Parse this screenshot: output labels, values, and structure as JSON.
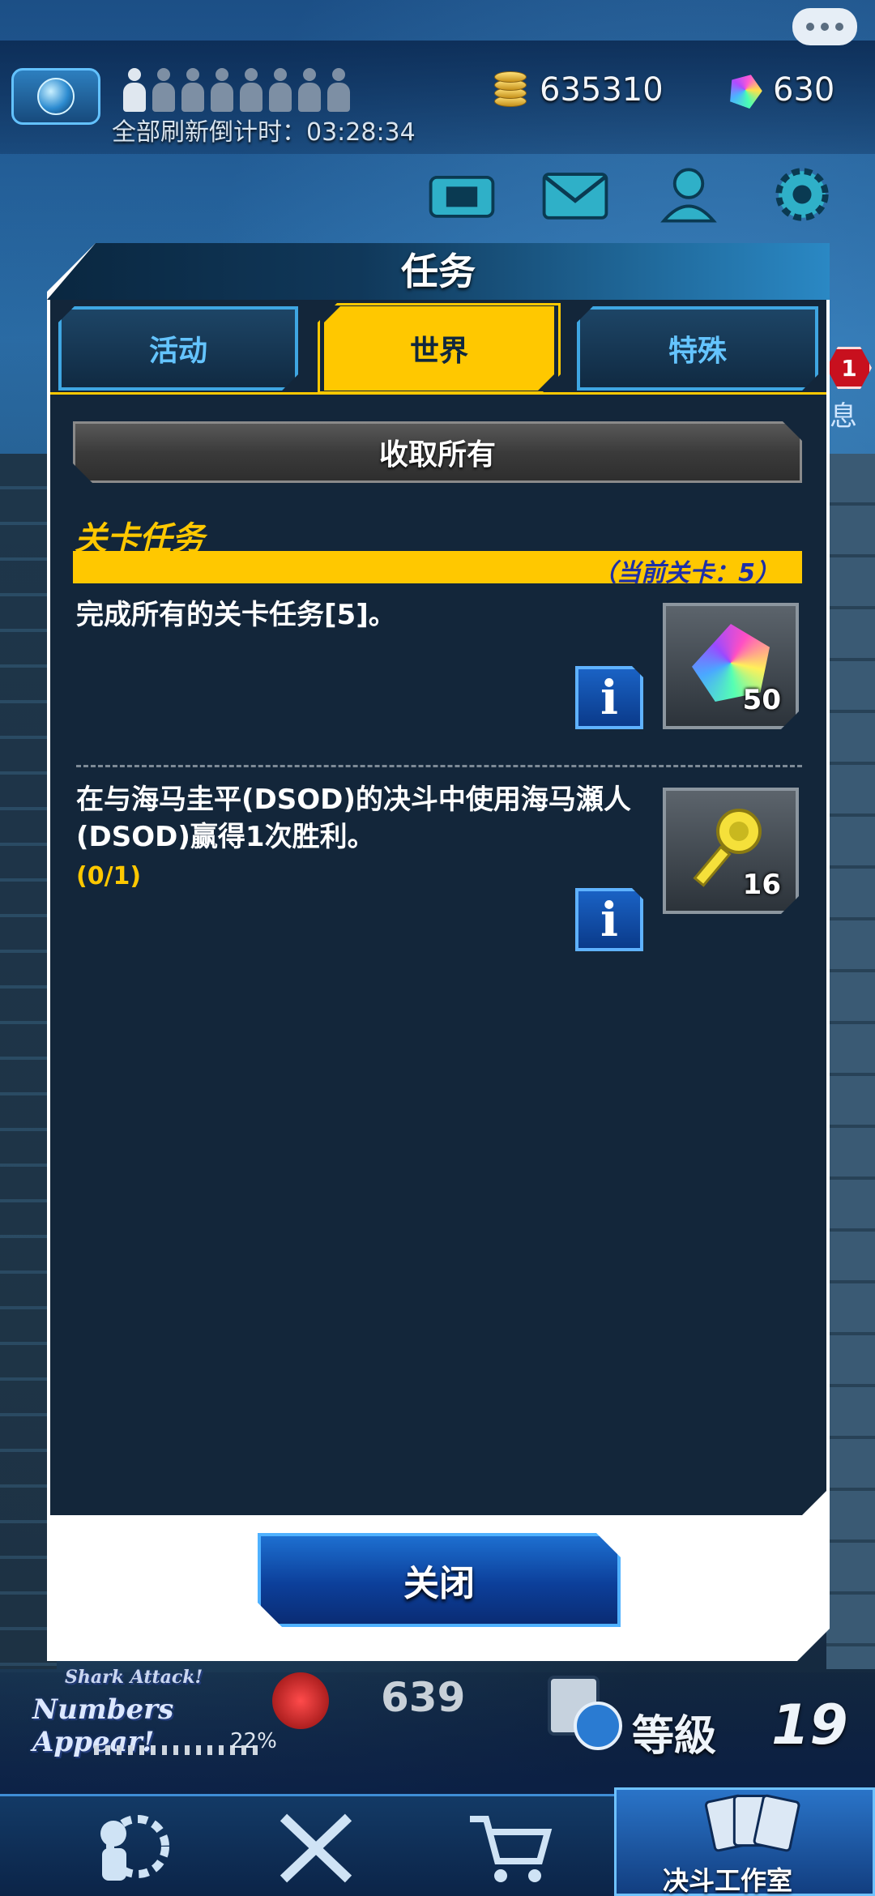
{
  "hud": {
    "refresh_label": "全部刷新倒计时：03:28:34",
    "coins": "635310",
    "gems": "630"
  },
  "modal": {
    "title": "任务",
    "tabs": [
      {
        "label": "活动",
        "active": false
      },
      {
        "label": "世界",
        "active": true
      },
      {
        "label": "特殊",
        "active": false
      }
    ],
    "collect_all_label": "收取所有",
    "section": {
      "title": "关卡任务",
      "current_stage": "（当前关卡：5）"
    },
    "missions": [
      {
        "text": "完成所有的关卡任务[5]。",
        "progress": "",
        "reward_icon": "gem-icon",
        "reward_count": "50"
      },
      {
        "text": "在与海马圭平(DSOD)的决斗中使用海马瀬人(DSOD)赢得1次胜利。",
        "progress": "(0/1)",
        "reward_icon": "key-icon",
        "reward_count": "16"
      }
    ],
    "close_label": "关闭"
  },
  "bottom": {
    "event_small": "Shark Attack!",
    "event_title": "Numbers Appear!",
    "stat_value": "639",
    "progress_percent": "22%",
    "level_label": "等級",
    "level_value": "19",
    "deck_label": "决斗工作室"
  },
  "side": {
    "badge": "1",
    "label": "息"
  },
  "colors": {
    "accent_yellow": "#ffc800",
    "panel_dark": "#13263a",
    "tab_blue": "#3fa6e2",
    "stage_text": "#1d2fa8"
  }
}
